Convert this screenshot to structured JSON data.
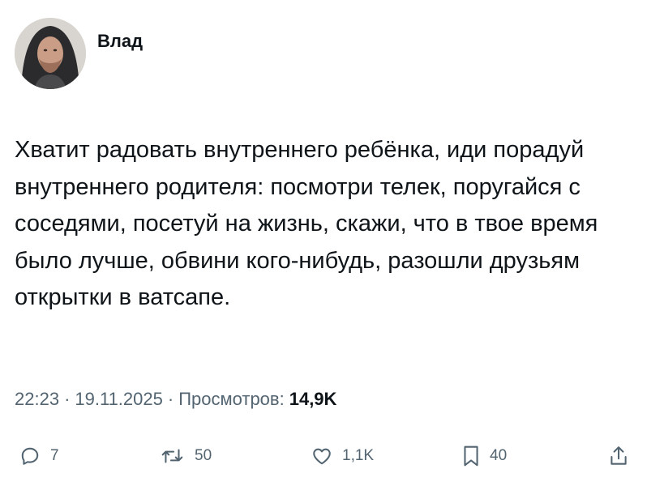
{
  "author": {
    "name": "Влад",
    "avatar_icon": "avatar-hooded-man"
  },
  "tweet": {
    "text": "Хватит радовать внутреннего ребёнка, иди порадуй внутреннего родителя: посмотри телек, поругайся с соседями, посетуй на жизнь, скажи, что в твое время было лучше, обвини кого-нибудь, разошли друзьям открытки в ватсапе."
  },
  "meta": {
    "time": "22:23",
    "separator": "·",
    "date": "19.11.2025",
    "views_label": "Просмотров:",
    "views_count": "14,9K"
  },
  "actions": {
    "reply": {
      "icon": "reply-icon",
      "count": "7"
    },
    "retweet": {
      "icon": "retweet-icon",
      "count": "50"
    },
    "like": {
      "icon": "heart-icon",
      "count": "1,1K"
    },
    "bookmark": {
      "icon": "bookmark-icon",
      "count": "40"
    },
    "share": {
      "icon": "share-icon"
    }
  },
  "colors": {
    "text": "#0f1419",
    "secondary": "#536471",
    "background": "#ffffff"
  }
}
